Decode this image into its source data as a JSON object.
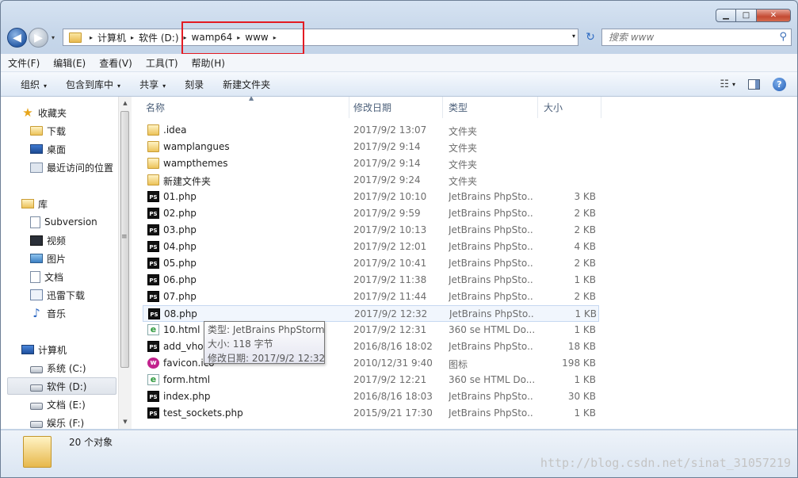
{
  "window": {
    "caption": {
      "minimize_glyph": "▁",
      "maximize_glyph": "□",
      "close_glyph": "✕"
    }
  },
  "address": {
    "crumbs": [
      "计算机",
      "软件 (D:)",
      "wamp64",
      "www"
    ],
    "sep": "▸",
    "dropdown": "▾"
  },
  "search": {
    "placeholder": "搜索 www"
  },
  "menu": [
    "文件(F)",
    "编辑(E)",
    "查看(V)",
    "工具(T)",
    "帮助(H)"
  ],
  "toolbar": {
    "organize": "组织",
    "include_in_library": "包含到库中",
    "share": "共享",
    "burn": "刻录",
    "new_folder": "新建文件夹",
    "dd": "▾",
    "help": "?"
  },
  "nav": {
    "favorites": "收藏夹",
    "downloads": "下载",
    "desktop": "桌面",
    "recent": "最近访问的位置",
    "libraries": "库",
    "subversion": "Subversion",
    "videos": "视频",
    "pictures": "图片",
    "documents": "文档",
    "xunlei": "迅雷下载",
    "music": "音乐",
    "computer": "计算机",
    "drive_c": "系统 (C:)",
    "drive_d": "软件 (D:)",
    "drive_e": "文档 (E:)",
    "drive_f": "娱乐 (F:)"
  },
  "columns": {
    "name": "名称",
    "date": "修改日期",
    "type": "类型",
    "size": "大小",
    "sort_glyph": "▲"
  },
  "files": [
    {
      "icon": "folder-icon",
      "name": ".idea",
      "date": "2017/9/2 13:07",
      "type": "文件夹",
      "size": ""
    },
    {
      "icon": "folder-icon",
      "name": "wamplangues",
      "date": "2017/9/2 9:14",
      "type": "文件夹",
      "size": ""
    },
    {
      "icon": "folder-icon",
      "name": "wampthemes",
      "date": "2017/9/2 9:14",
      "type": "文件夹",
      "size": ""
    },
    {
      "icon": "folder-icon",
      "name": "新建文件夹",
      "date": "2017/9/2 9:24",
      "type": "文件夹",
      "size": ""
    },
    {
      "icon": "phpstorm-file-icon",
      "name": "01.php",
      "date": "2017/9/2 10:10",
      "type": "JetBrains PhpSto...",
      "size": "3 KB"
    },
    {
      "icon": "phpstorm-file-icon",
      "name": "02.php",
      "date": "2017/9/2 9:59",
      "type": "JetBrains PhpSto...",
      "size": "2 KB"
    },
    {
      "icon": "phpstorm-file-icon",
      "name": "03.php",
      "date": "2017/9/2 10:13",
      "type": "JetBrains PhpSto...",
      "size": "2 KB"
    },
    {
      "icon": "phpstorm-file-icon",
      "name": "04.php",
      "date": "2017/9/2 12:01",
      "type": "JetBrains PhpSto...",
      "size": "4 KB"
    },
    {
      "icon": "phpstorm-file-icon",
      "name": "05.php",
      "date": "2017/9/2 10:41",
      "type": "JetBrains PhpSto...",
      "size": "2 KB"
    },
    {
      "icon": "phpstorm-file-icon",
      "name": "06.php",
      "date": "2017/9/2 11:38",
      "type": "JetBrains PhpSto...",
      "size": "1 KB"
    },
    {
      "icon": "phpstorm-file-icon",
      "name": "07.php",
      "date": "2017/9/2 11:44",
      "type": "JetBrains PhpSto...",
      "size": "2 KB"
    },
    {
      "icon": "phpstorm-file-icon",
      "name": "08.php",
      "date": "2017/9/2 12:32",
      "type": "JetBrains PhpSto...",
      "size": "1 KB"
    },
    {
      "icon": "html-file-icon",
      "name": "10.html",
      "date": "2017/9/2 12:31",
      "type": "360 se HTML Do...",
      "size": "1 KB"
    },
    {
      "icon": "phpstorm-file-icon",
      "name": "add_vhos",
      "date": "2016/8/16 18:02",
      "type": "JetBrains PhpSto...",
      "size": "18 KB"
    },
    {
      "icon": "wamp-ico-icon",
      "name": "favicon.ico",
      "date": "2010/12/31 9:40",
      "type": "图标",
      "size": "198 KB"
    },
    {
      "icon": "html-file-icon",
      "name": "form.html",
      "date": "2017/9/2 12:21",
      "type": "360 se HTML Do...",
      "size": "1 KB"
    },
    {
      "icon": "phpstorm-file-icon",
      "name": "index.php",
      "date": "2016/8/16 18:03",
      "type": "JetBrains PhpSto...",
      "size": "30 KB"
    },
    {
      "icon": "phpstorm-file-icon",
      "name": "test_sockets.php",
      "date": "2015/9/21 17:30",
      "type": "JetBrains PhpSto...",
      "size": "1 KB"
    }
  ],
  "tooltip": {
    "line1": "类型: JetBrains PhpStorm",
    "line2": "大小: 118 字节",
    "line3": "修改日期: 2017/9/2 12:32"
  },
  "status": {
    "count": "20 个对象"
  },
  "watermark": "http://blog.csdn.net/sinat_31057219"
}
